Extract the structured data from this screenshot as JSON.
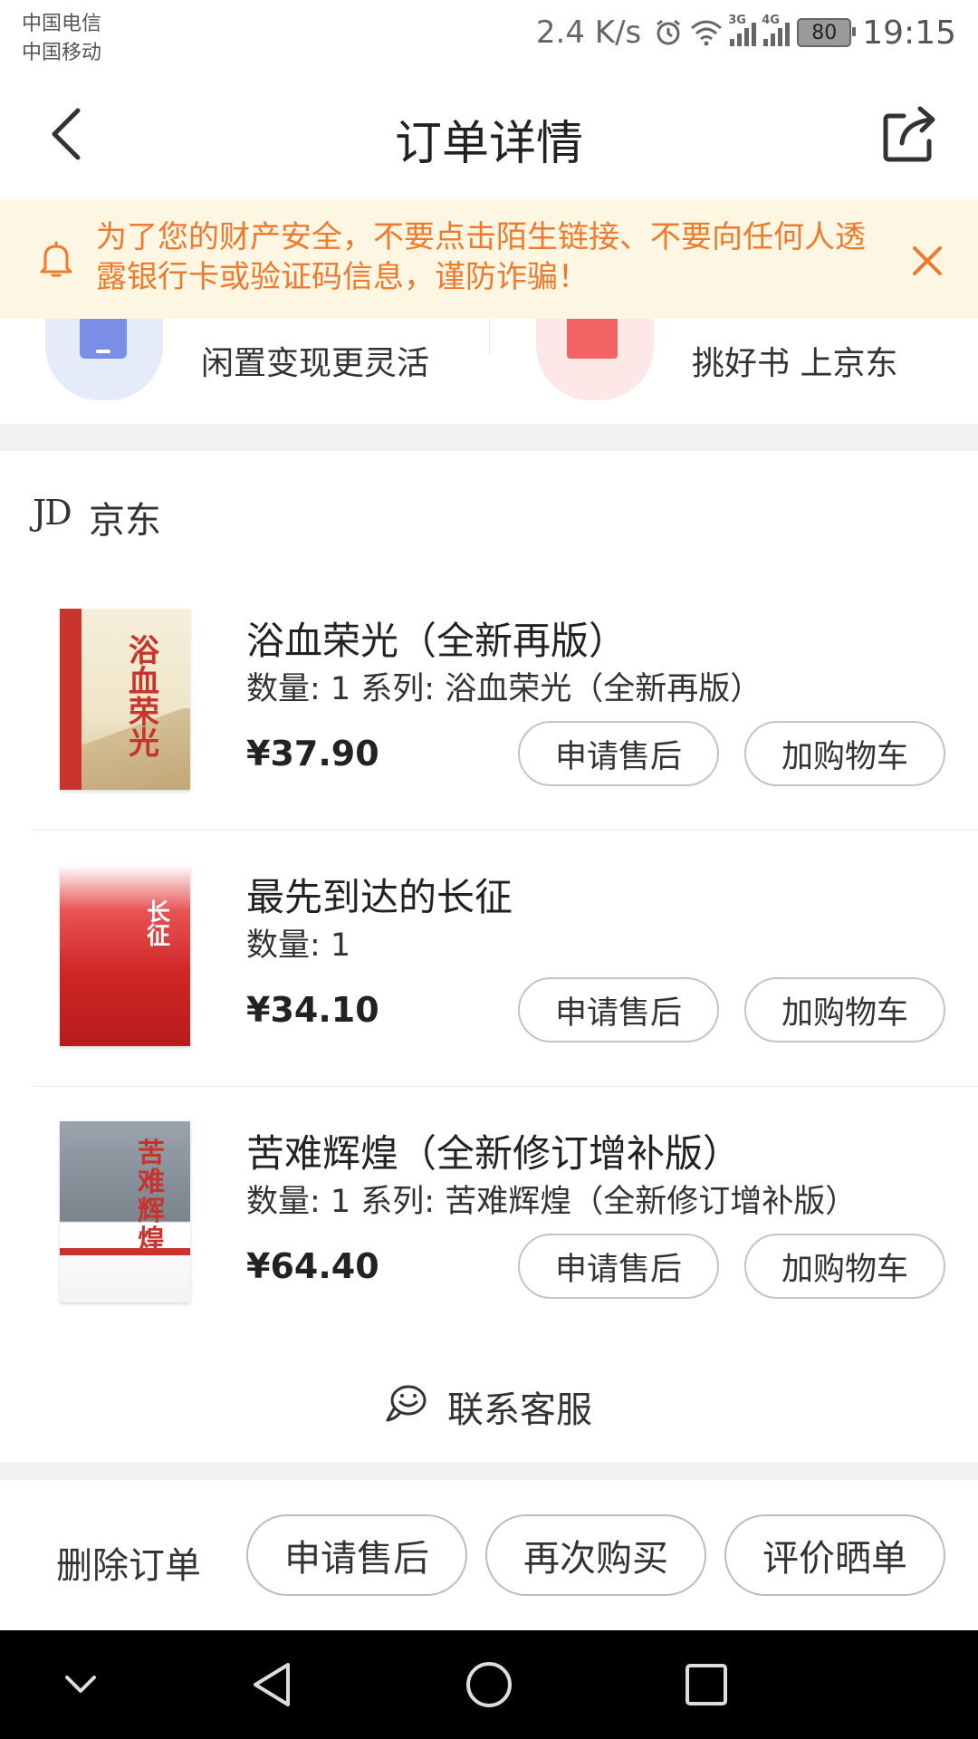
{
  "status_bar": {
    "carrier1": "中国电信",
    "carrier2": "中国移动",
    "speed": "2.4 K/s",
    "net1": "3G",
    "net2": "4G",
    "battery": "80",
    "time": "19:15"
  },
  "nav": {
    "title": "订单详情"
  },
  "warning": {
    "text": "为了您的财产安全，不要点击陌生链接、不要向任何人透露银行卡或验证码信息，谨防诈骗！"
  },
  "promo": {
    "left_text": "闲置变现更灵活",
    "right_text": "挑好书 上京东"
  },
  "shop": {
    "logo": "JD",
    "name": "京东"
  },
  "items": [
    {
      "name": "浴血荣光（全新再版）",
      "meta": "数量: 1 系列: 浴血荣光（全新再版）",
      "price": "¥37.90",
      "after_sale": "申请售后",
      "add_cart": "加购物车",
      "cover_title": "浴血荣光"
    },
    {
      "name": "最先到达的长征",
      "meta": "数量: 1",
      "price": "¥34.10",
      "after_sale": "申请售后",
      "add_cart": "加购物车",
      "cover_title": "长征"
    },
    {
      "name": "苦难辉煌（全新修订增补版）",
      "meta": "数量: 1 系列: 苦难辉煌（全新修订增补版）",
      "price": "¥64.40",
      "after_sale": "申请售后",
      "add_cart": "加购物车",
      "cover_title": "苦难辉煌"
    }
  ],
  "contact": {
    "label": "联系客服"
  },
  "actions": {
    "delete": "删除订单",
    "after_sale": "申请售后",
    "rebuy": "再次购买",
    "review": "评价晒单"
  },
  "colors": {
    "warning_bg": "#fdf6e3",
    "warning_text": "#f07a2c",
    "accent_red": "#e4393c"
  }
}
